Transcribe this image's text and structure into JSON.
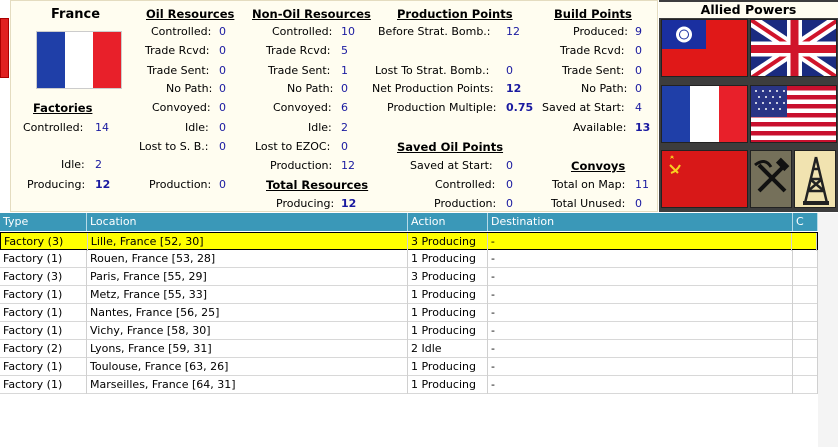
{
  "nation": "France",
  "factories": {
    "title": "Factories",
    "controlled_label": "Controlled:",
    "controlled": "14",
    "idle_label": "Idle:",
    "idle": "2",
    "producing_label": "Producing:",
    "producing": "12"
  },
  "oil": {
    "title": "Oil Resources",
    "controlled_label": "Controlled:",
    "controlled": "0",
    "trade_rcvd_label": "Trade Rcvd:",
    "trade_rcvd": "0",
    "trade_sent_label": "Trade Sent:",
    "trade_sent": "0",
    "no_path_label": "No Path:",
    "no_path": "0",
    "convoyed_label": "Convoyed:",
    "convoyed": "0",
    "idle_label": "Idle:",
    "idle": "0",
    "lost_sb_label": "Lost to S. B.:",
    "lost_sb": "0",
    "production_label": "Production:",
    "production": "0"
  },
  "nonoil": {
    "title": "Non-Oil Resources",
    "controlled_label": "Controlled:",
    "controlled": "10",
    "trade_rcvd_label": "Trade Rcvd:",
    "trade_rcvd": "5",
    "trade_sent_label": "Trade Sent:",
    "trade_sent": "1",
    "no_path_label": "No Path:",
    "no_path": "0",
    "convoyed_label": "Convoyed:",
    "convoyed": "6",
    "idle_label": "Idle:",
    "idle": "2",
    "lost_ezoc_label": "Lost to EZOC:",
    "lost_ezoc": "0",
    "production_label": "Production:",
    "production": "12"
  },
  "total_resources": {
    "title": "Total Resources",
    "producing_label": "Producing:",
    "producing": "12"
  },
  "production_points": {
    "title": "Production Points",
    "before_label": "Before Strat. Bomb.:",
    "before": "12",
    "lost_label": "Lost To Strat. Bomb.:",
    "lost": "0",
    "net_label": "Net Production Points:",
    "net": "12",
    "multiple_label": "Production Multiple:",
    "multiple": "0.75"
  },
  "saved_oil": {
    "title": "Saved Oil Points",
    "saved_start_label": "Saved at Start:",
    "saved_start": "0",
    "controlled_label": "Controlled:",
    "controlled": "0",
    "production_label": "Production:",
    "production": "0"
  },
  "build_points": {
    "title": "Build Points",
    "produced_label": "Produced:",
    "produced": "9",
    "trade_rcvd_label": "Trade Rcvd:",
    "trade_rcvd": "0",
    "trade_sent_label": "Trade Sent:",
    "trade_sent": "0",
    "no_path_label": "No Path:",
    "no_path": "0",
    "saved_start_label": "Saved at Start:",
    "saved_start": "4",
    "available_label": "Available:",
    "available": "13"
  },
  "convoys": {
    "title": "Convoys",
    "total_map_label": "Total on Map:",
    "total_map": "11",
    "total_unused_label": "Total Unused:",
    "total_unused": "0"
  },
  "allied": {
    "title": "Allied Powers"
  },
  "table": {
    "headers": [
      "Type",
      "Location",
      "Action",
      "Destination",
      "C"
    ],
    "rows": [
      [
        "Factory (3)",
        "Lille, France [52, 30]",
        "3 Producing",
        "-",
        ""
      ],
      [
        "Factory (1)",
        "Rouen, France [53, 28]",
        "1 Producing",
        "-",
        ""
      ],
      [
        "Factory (3)",
        "Paris, France [55, 29]",
        "3 Producing",
        "-",
        ""
      ],
      [
        "Factory (1)",
        "Metz, France [55, 33]",
        "1 Producing",
        "-",
        ""
      ],
      [
        "Factory (1)",
        "Nantes, France [56, 25]",
        "1 Producing",
        "-",
        ""
      ],
      [
        "Factory (1)",
        "Vichy, France [58, 30]",
        "1 Producing",
        "-",
        ""
      ],
      [
        "Factory (2)",
        "Lyons, France [59, 31]",
        "2 Idle",
        "-",
        ""
      ],
      [
        "Factory (1)",
        "Toulouse, France [63, 26]",
        "1 Producing",
        "-",
        ""
      ],
      [
        "Factory (1)",
        "Marseilles, France [64, 31]",
        "1 Producing",
        "-",
        ""
      ]
    ]
  },
  "colors": {
    "header_bg": "#3a98b8",
    "selected_row": "#ffff00",
    "value_text": "#1a1aa0",
    "panel_bg": "#fffdf0"
  }
}
